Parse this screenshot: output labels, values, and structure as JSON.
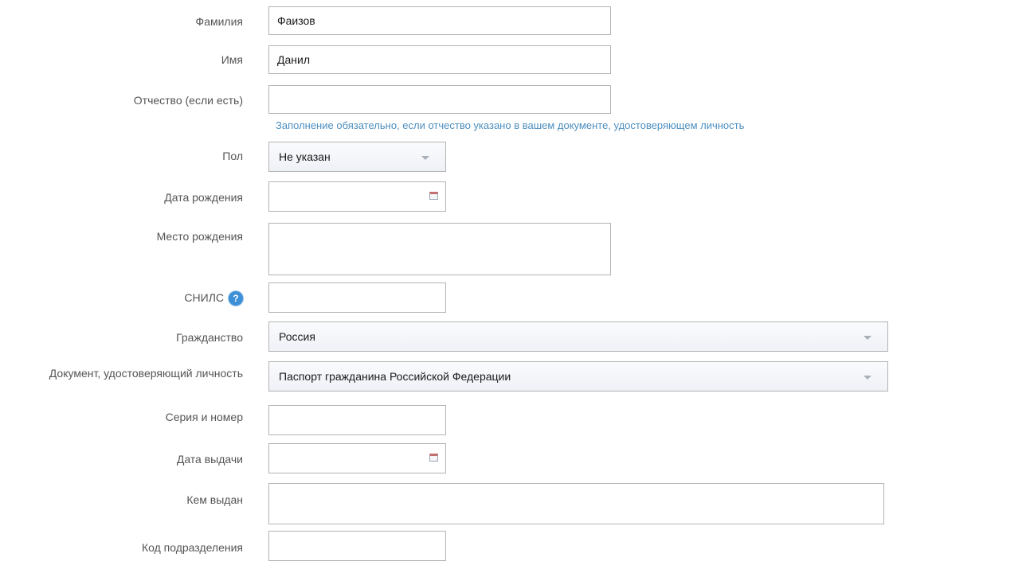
{
  "form": {
    "surname": {
      "label": "Фамилия",
      "value": "Фаизов"
    },
    "name": {
      "label": "Имя",
      "value": "Данил"
    },
    "patronymic": {
      "label": "Отчество (если есть)",
      "value": "",
      "hint": "Заполнение обязательно, если отчество указано в вашем документе, удостоверяющем личность"
    },
    "gender": {
      "label": "Пол",
      "selected": "Не указан"
    },
    "birth_date": {
      "label": "Дата рождения",
      "value": ""
    },
    "birth_place": {
      "label": "Место рождения",
      "value": ""
    },
    "snils": {
      "label": "СНИЛС",
      "help_glyph": "?",
      "value": ""
    },
    "citizenship": {
      "label": "Гражданство",
      "selected": "Россия"
    },
    "id_document": {
      "label": "Документ, удостоверяющий личность",
      "selected": "Паспорт гражданина Российской Федерации"
    },
    "series_number": {
      "label": "Серия и номер",
      "value": ""
    },
    "issue_date": {
      "label": "Дата выдачи",
      "value": ""
    },
    "issued_by": {
      "label": "Кем выдан",
      "value": ""
    },
    "division_code": {
      "label": "Код подразделения",
      "value": ""
    }
  },
  "icons": {
    "dropdown": "chevron-down-icon",
    "calendar": "calendar-icon",
    "help": "help-circle-icon"
  }
}
